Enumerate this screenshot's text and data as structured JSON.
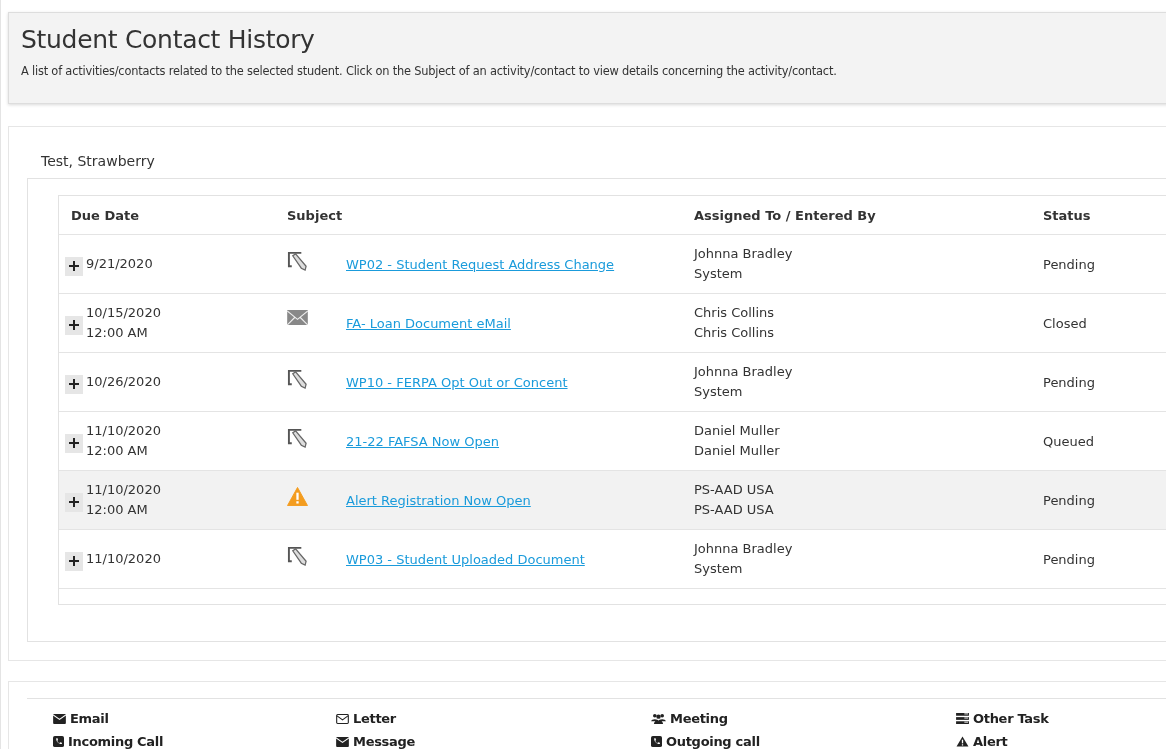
{
  "header": {
    "title": "Student Contact History",
    "description": "A list of activities/contacts related to the selected student. Click on the Subject of an activity/contact to view details concerning the activity/contact."
  },
  "student": "Test, Strawberry",
  "table": {
    "columns": [
      "Due Date",
      "Subject",
      "Assigned To / Entered By",
      "Status"
    ],
    "rows": [
      {
        "date": "9/21/2020",
        "time": "",
        "kind": "task",
        "subject": "WP02 - Student Request Address Change",
        "assigned_to": "Johnna Bradley",
        "entered_by": "System",
        "status": "Pending",
        "highlighted": false
      },
      {
        "date": "10/15/2020",
        "time": "12:00 AM",
        "kind": "email",
        "subject": "FA- Loan Document eMail",
        "assigned_to": "Chris Collins",
        "entered_by": "Chris Collins",
        "status": "Closed",
        "highlighted": false
      },
      {
        "date": "10/26/2020",
        "time": "",
        "kind": "task",
        "subject": "WP10 - FERPA Opt Out or Concent",
        "assigned_to": "Johnna Bradley",
        "entered_by": "System",
        "status": "Pending",
        "highlighted": false
      },
      {
        "date": "11/10/2020",
        "time": "12:00 AM",
        "kind": "task",
        "subject": "21-22 FAFSA Now Open",
        "assigned_to": "Daniel Muller",
        "entered_by": "Daniel Muller",
        "status": "Queued",
        "highlighted": false
      },
      {
        "date": "11/10/2020",
        "time": "12:00 AM",
        "kind": "alert",
        "subject": "Alert Registration Now Open",
        "assigned_to": "PS-AAD USA",
        "entered_by": "PS-AAD USA",
        "status": "Pending",
        "highlighted": true
      },
      {
        "date": "11/10/2020",
        "time": "",
        "kind": "task",
        "subject": "WP03 - Student Uploaded Document",
        "assigned_to": "Johnna Bradley",
        "entered_by": "System",
        "status": "Pending",
        "highlighted": false
      }
    ]
  },
  "legend": [
    {
      "kind": "email",
      "label": "Email"
    },
    {
      "kind": "letter",
      "label": "Letter"
    },
    {
      "kind": "meeting",
      "label": "Meeting"
    },
    {
      "kind": "other",
      "label": "Other Task"
    },
    {
      "kind": "phone",
      "label": "Incoming Call"
    },
    {
      "kind": "email",
      "label": "Message"
    },
    {
      "kind": "phone",
      "label": "Outgoing call"
    },
    {
      "kind": "alert",
      "label": "Alert"
    }
  ]
}
